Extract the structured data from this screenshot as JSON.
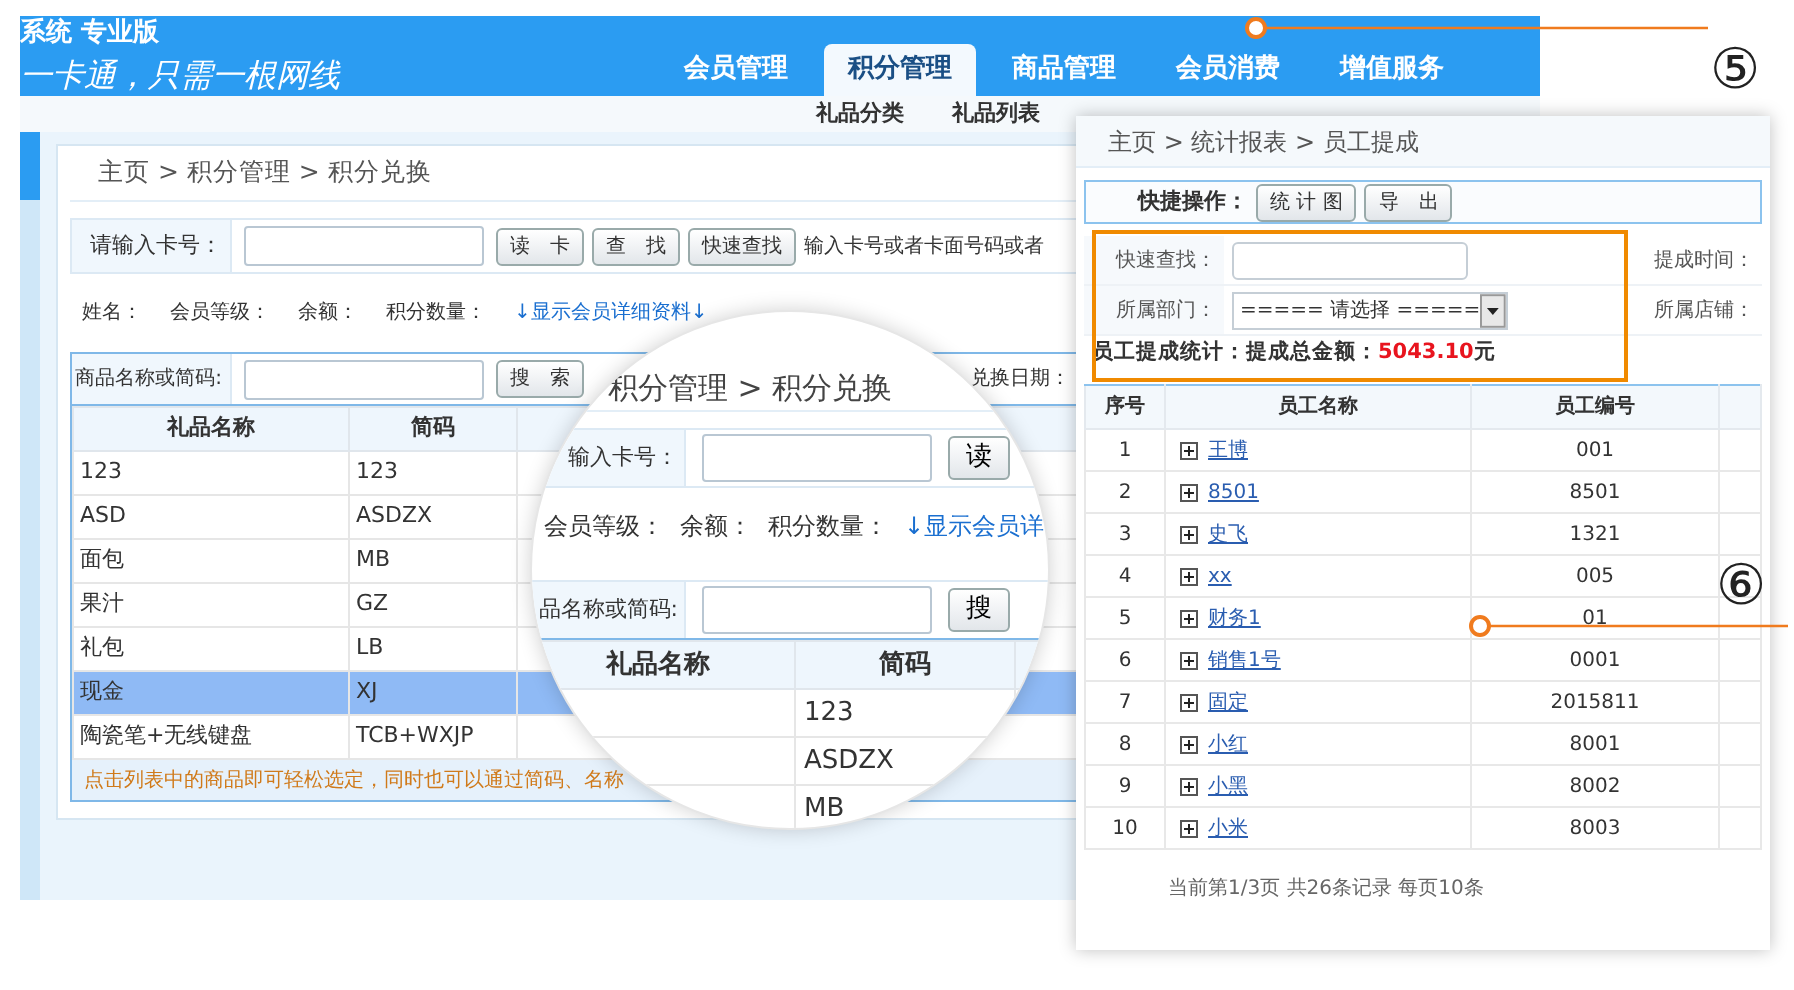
{
  "back_window": {
    "brand": "系统 专业版",
    "slogan": "一卡通，只需一根网线",
    "nav_tabs": [
      {
        "label": "会员管理",
        "selected": false
      },
      {
        "label": "积分管理",
        "selected": true
      },
      {
        "label": "商品管理",
        "selected": false
      },
      {
        "label": "会员消费",
        "selected": false
      },
      {
        "label": "增值服务",
        "selected": false
      }
    ],
    "sub_nav": [
      "礼品分类",
      "礼品列表"
    ],
    "breadcrumb": "主页 > 积分管理 > 积分兑换",
    "card_form": {
      "label": "请输入卡号：",
      "buttons": [
        "读　卡",
        "查　找",
        "快速查找"
      ],
      "hint": "输入卡号或者卡面号码或者"
    },
    "member_info": [
      "姓名：",
      "会员等级：",
      "余额：",
      "积分数量："
    ],
    "detail_link": "↓显示会员详细资料↓",
    "product_search": {
      "label": "商品名称或简码:",
      "button": "搜　索",
      "date_label": "兑换日期："
    },
    "gift_table": {
      "columns": [
        "礼品名称",
        "简码"
      ],
      "rows": [
        {
          "cells": [
            "123",
            "123"
          ],
          "selected": false
        },
        {
          "cells": [
            "ASD",
            "ASDZX"
          ],
          "selected": false
        },
        {
          "cells": [
            "面包",
            "MB"
          ],
          "selected": false
        },
        {
          "cells": [
            "果汁",
            "GZ"
          ],
          "selected": false
        },
        {
          "cells": [
            "礼包",
            "LB"
          ],
          "selected": false
        },
        {
          "cells": [
            "现金",
            "XJ"
          ],
          "selected": true
        },
        {
          "cells": [
            "陶瓷笔+无线键盘",
            "TCB+WXJP"
          ],
          "selected": false
        }
      ]
    },
    "footer_hint": "点击列表中的商品即可轻松选定，同时也可以通过简码、名称"
  },
  "magnifier": {
    "breadcrumb": "积分管理 > 积分兑换",
    "card_label": "输入卡号：",
    "read_button": "读",
    "member_info": [
      "会员等级：",
      "余额：",
      "积分数量："
    ],
    "detail_link": "↓显示会员详",
    "search_label": "品名称或简码:",
    "search_button": "搜",
    "columns": [
      "礼品名称",
      "简码"
    ],
    "codes": [
      "123",
      "ASDZX",
      "MB"
    ]
  },
  "report_window": {
    "breadcrumb": "主页 > 统计报表 > 员工提成",
    "quick_ops": {
      "label": "快捷操作：",
      "buttons": [
        "统 计 图",
        "导　出"
      ]
    },
    "filters": [
      {
        "label": "快速查找：",
        "kind": "text",
        "right_label": "提成时间："
      },
      {
        "label": "所属部门：",
        "kind": "select",
        "value": "===== 请选择 =====",
        "right_label": "所属店铺："
      }
    ],
    "stats": {
      "label": "员工提成统计：提成总金额：",
      "amount": "5043.10",
      "unit": "元"
    },
    "columns": [
      "序号",
      "员工名称",
      "员工编号"
    ],
    "rows": [
      {
        "index": "1",
        "name": "王博",
        "code": "001"
      },
      {
        "index": "2",
        "name": "8501",
        "code": "8501"
      },
      {
        "index": "3",
        "name": "史飞",
        "code": "1321"
      },
      {
        "index": "4",
        "name": "xx",
        "code": "005"
      },
      {
        "index": "5",
        "name": "财务1",
        "code": "01"
      },
      {
        "index": "6",
        "name": "销售1号",
        "code": "0001"
      },
      {
        "index": "7",
        "name": "固定",
        "code": "2015811"
      },
      {
        "index": "8",
        "name": "小红",
        "code": "8001"
      },
      {
        "index": "9",
        "name": "小黑",
        "code": "8002"
      },
      {
        "index": "10",
        "name": "小米",
        "code": "8003"
      }
    ],
    "pager": "当前第1/3页 共26条记录 每页10条"
  },
  "callouts": [
    {
      "number": "⑤"
    },
    {
      "number": "⑥"
    }
  ]
}
